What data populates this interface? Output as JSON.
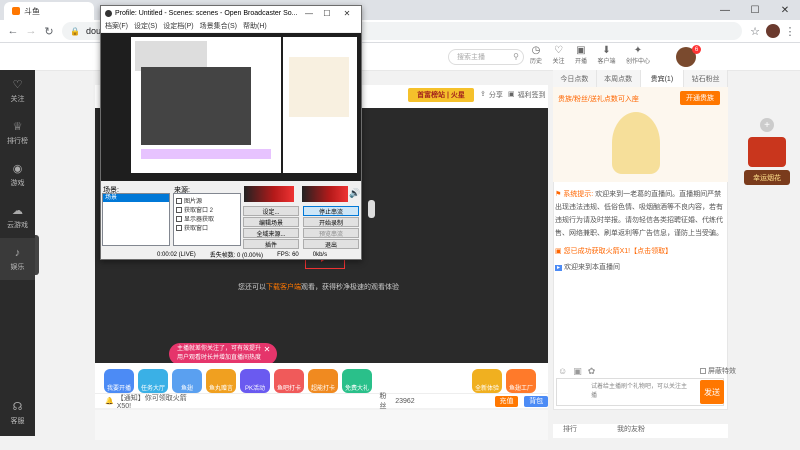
{
  "browser": {
    "tab_title": "斗鱼",
    "address": "douyu",
    "window_controls": [
      "—",
      "☐",
      "✕"
    ]
  },
  "obs": {
    "title": "Profile: Untitled - Scenes: scenes - Open Broadcaster So...",
    "menu": [
      "档案(F)",
      "设定(S)",
      "设定档(P)",
      "场景集合(S)",
      "帮助(H)"
    ],
    "scenes_label": "场景:",
    "scene_items": [
      "场景"
    ],
    "sources_label": "来源:",
    "sources": [
      "图片源",
      "获取窗口 2",
      "显示器获取",
      "获取窗口"
    ],
    "buttons": {
      "settings": "设定...",
      "stop_stream": "停止串流",
      "edit_scene": "编辑场景",
      "start_record": "开始录制",
      "global_sources": "全域来源...",
      "preview_stream": "预览串流",
      "plugins": "插件",
      "exit": "退出"
    },
    "status": {
      "time": "0:00:02 (LIVE)",
      "dropped": "丢失帧数: 0 (0.00%)",
      "fps": "FPS: 60",
      "bitrate": "0kb/s"
    }
  },
  "nav": {
    "search_placeholder": "搜索主播",
    "icons": [
      "关注",
      "开播",
      "客户端",
      "历史",
      "创作中心"
    ],
    "avatar_badge": "6"
  },
  "sidebar": {
    "items": [
      "关注",
      "排行榜",
      "游戏",
      "云游戏",
      "娱乐",
      "客服"
    ]
  },
  "stream": {
    "share": "分享",
    "welfare": "福利签到",
    "banner": "首富榜站 | 火星",
    "overlay_text_prefix": "您还可以",
    "overlay_link": "下载客户端",
    "overlay_text_suffix": "观看，获得秒净极速的观看体验",
    "alert_text": "主播就差你关注了，可有效提升用户观看时长并增加直播间热度",
    "gifts": [
      "我要开播",
      "任务大厅",
      "鱼翅",
      "鱼丸赠言",
      "PK活动",
      "鱼吧打卡",
      "超能打卡",
      "免费大礼"
    ],
    "gifts_right": [
      "全新体验",
      "鱼翅工厂"
    ],
    "notice": "【通知】你可领取火箭X50!",
    "fans_label": "粉丝",
    "fans": "23962",
    "recharge": "充值",
    "backpack": "背包"
  },
  "right_panel": {
    "tabs": [
      "今日点数",
      "本周点数",
      "贵宾(1)",
      "钻石粉丝"
    ],
    "rank_text": "贵族/粉丝/送礼点数可入座",
    "open_noble": "开通贵族",
    "chat_system_label": "系统提示:",
    "chat_system": "欢迎来到一老葛的直播间。直播期间严禁出现违法违规、低俗色情、吸烟酗酒等不良内容，若有违规行为请及时举报。请勿轻信各类招聘征婚、代练代售、网络兼职、刷单返利等广告信息，谨防上当受骗。",
    "chat_gain": "您已成功获取火箭X1!【点击领取】",
    "chat_user": "欢迎来到本直播间",
    "shield_label": "屏蔽特效",
    "input_placeholder": "试着给主播刷个礼物吧，可以关注主播",
    "send": "发送",
    "bottom_tabs": [
      "排行",
      "我的友粉"
    ]
  },
  "ad": {
    "label": "幸运烟花"
  }
}
